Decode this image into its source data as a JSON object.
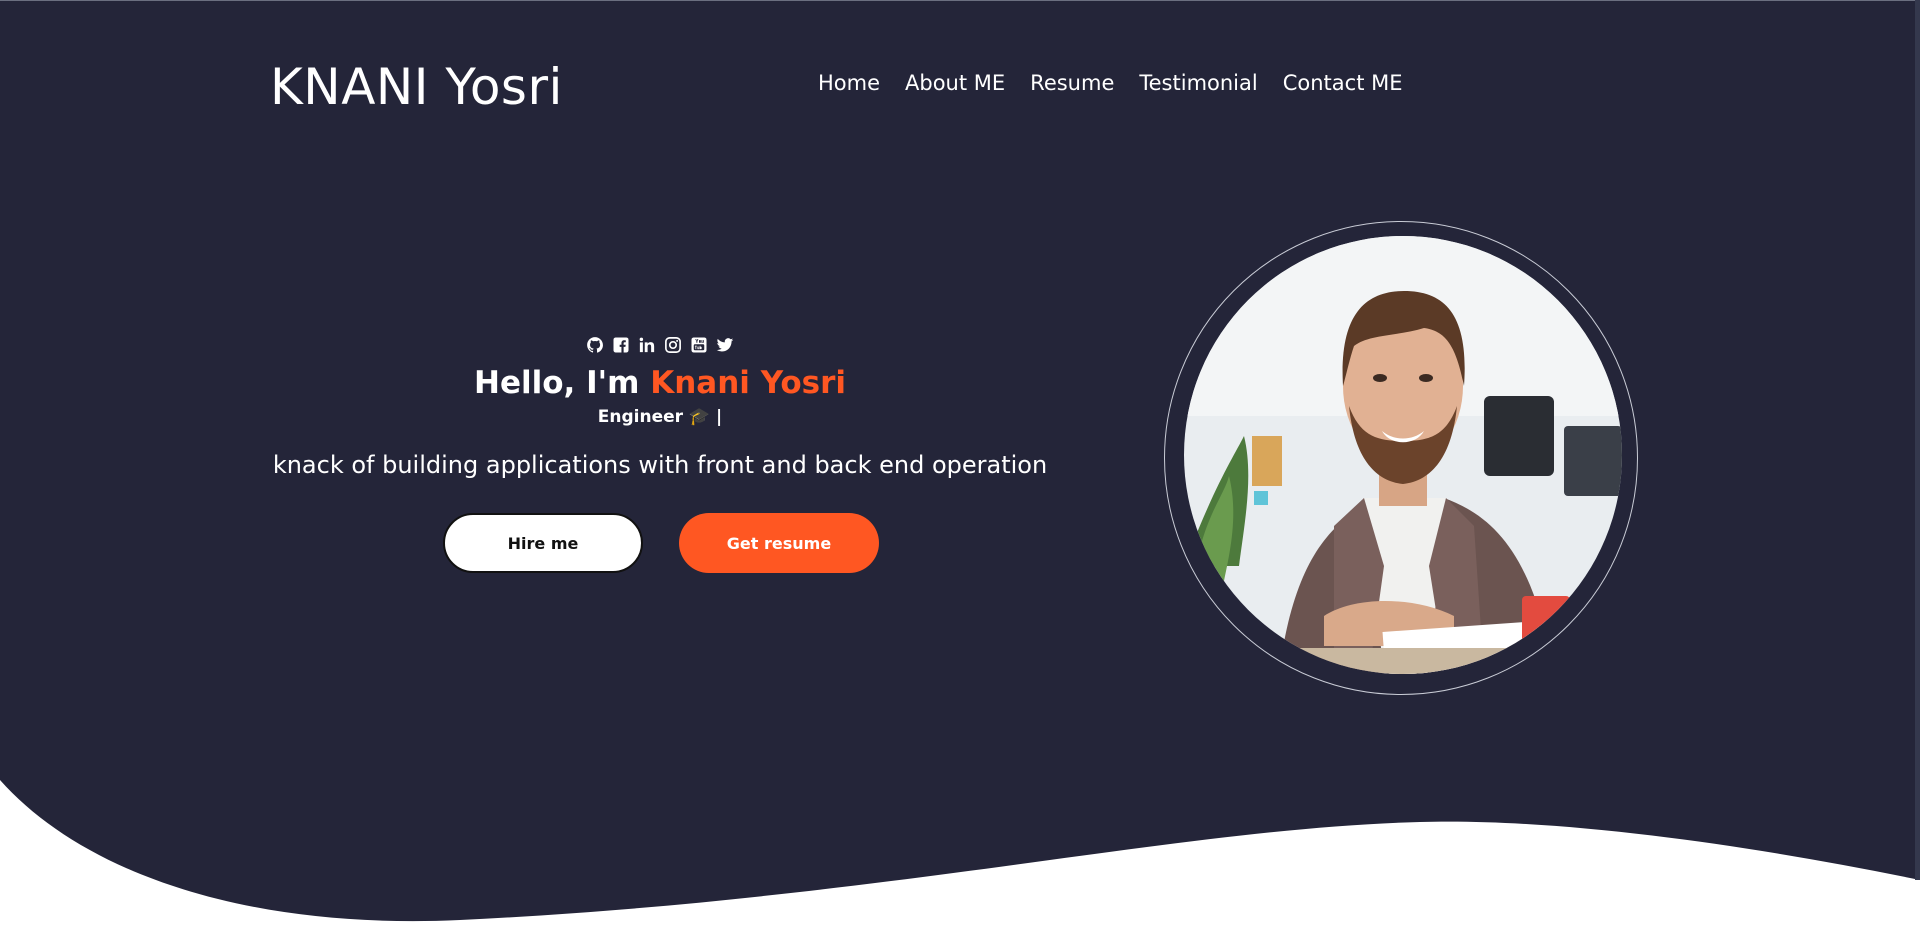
{
  "header": {
    "logo_text": "KNANI Yosri"
  },
  "nav": {
    "items": [
      {
        "label": "Home"
      },
      {
        "label": "About ME"
      },
      {
        "label": "Resume"
      },
      {
        "label": "Testimonial"
      },
      {
        "label": "Contact ME"
      }
    ]
  },
  "hero": {
    "socials": [
      {
        "icon": "github-icon"
      },
      {
        "icon": "facebook-icon"
      },
      {
        "icon": "linkedin-icon"
      },
      {
        "icon": "instagram-icon"
      },
      {
        "icon": "youtube-icon"
      },
      {
        "icon": "twitter-icon"
      }
    ],
    "greeting_prefix": "Hello, I'm ",
    "name": "Knani Yosri",
    "role": "Engineer 🎓 |",
    "tagline": "knack of building applications with front and back end operation",
    "hire_button": "Hire me",
    "resume_button": "Get resume",
    "portrait": "profile-photo"
  },
  "colors": {
    "background": "#242539",
    "accent": "#ff5722",
    "text": "#ffffff",
    "footer_wave": "#ffffff"
  }
}
